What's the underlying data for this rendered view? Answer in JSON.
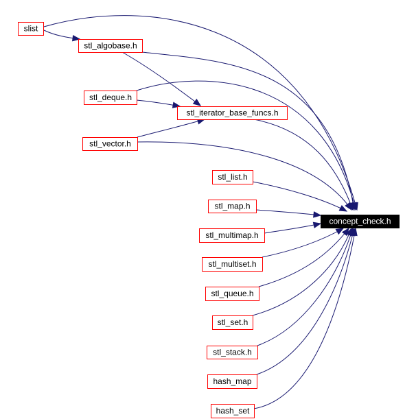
{
  "diagram": {
    "type": "include-dependency-graph",
    "edge_color": "#191970",
    "node_border_color": "#ff0000",
    "root_fill_color": "#000000",
    "root": "concept_check",
    "nodes": [
      {
        "id": "slist",
        "label": "slist"
      },
      {
        "id": "stl_algobase",
        "label": "stl_algobase.h"
      },
      {
        "id": "stl_deque",
        "label": "stl_deque.h"
      },
      {
        "id": "stl_iterator_base_funcs",
        "label": "stl_iterator_base_funcs.h"
      },
      {
        "id": "stl_vector",
        "label": "stl_vector.h"
      },
      {
        "id": "stl_list",
        "label": "stl_list.h"
      },
      {
        "id": "stl_map",
        "label": "stl_map.h"
      },
      {
        "id": "concept_check",
        "label": "concept_check.h"
      },
      {
        "id": "stl_multimap",
        "label": "stl_multimap.h"
      },
      {
        "id": "stl_multiset",
        "label": "stl_multiset.h"
      },
      {
        "id": "stl_queue",
        "label": "stl_queue.h"
      },
      {
        "id": "stl_set",
        "label": "stl_set.h"
      },
      {
        "id": "stl_stack",
        "label": "stl_stack.h"
      },
      {
        "id": "hash_map",
        "label": "hash_map"
      },
      {
        "id": "hash_set",
        "label": "hash_set"
      }
    ],
    "edges": [
      {
        "from": "slist",
        "to": "stl_algobase"
      },
      {
        "from": "slist",
        "to": "concept_check"
      },
      {
        "from": "stl_algobase",
        "to": "stl_iterator_base_funcs"
      },
      {
        "from": "stl_algobase",
        "to": "concept_check"
      },
      {
        "from": "stl_deque",
        "to": "stl_iterator_base_funcs"
      },
      {
        "from": "stl_deque",
        "to": "concept_check"
      },
      {
        "from": "stl_iterator_base_funcs",
        "to": "concept_check"
      },
      {
        "from": "stl_vector",
        "to": "stl_iterator_base_funcs"
      },
      {
        "from": "stl_vector",
        "to": "concept_check"
      },
      {
        "from": "stl_list",
        "to": "concept_check"
      },
      {
        "from": "stl_map",
        "to": "concept_check"
      },
      {
        "from": "stl_multimap",
        "to": "concept_check"
      },
      {
        "from": "stl_multiset",
        "to": "concept_check"
      },
      {
        "from": "stl_queue",
        "to": "concept_check"
      },
      {
        "from": "stl_set",
        "to": "concept_check"
      },
      {
        "from": "stl_stack",
        "to": "concept_check"
      },
      {
        "from": "hash_map",
        "to": "concept_check"
      },
      {
        "from": "hash_set",
        "to": "concept_check"
      }
    ]
  }
}
